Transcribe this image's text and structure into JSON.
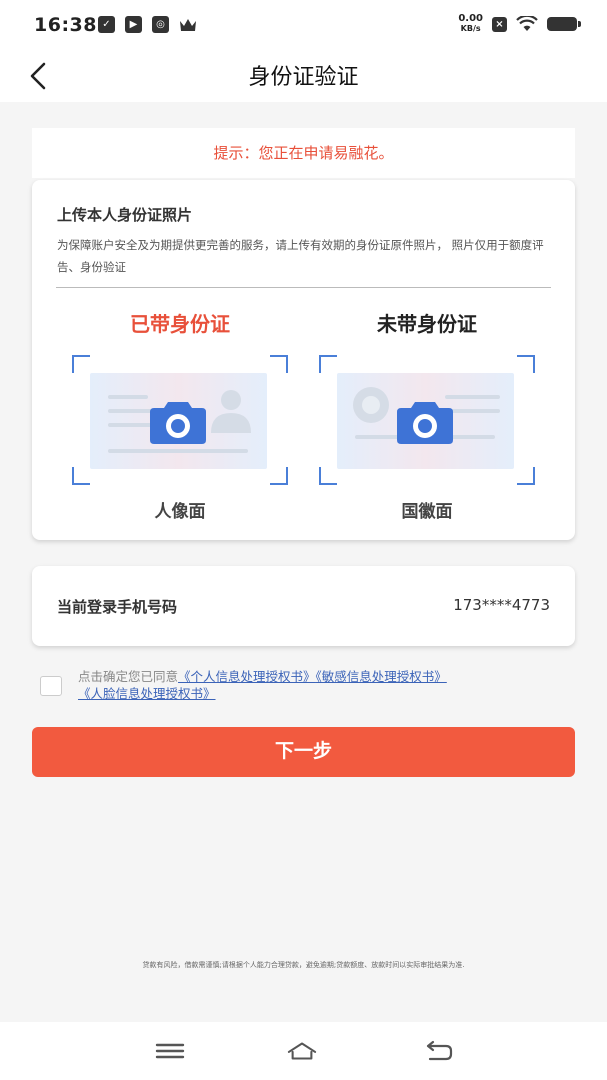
{
  "status_bar": {
    "time": "16:38",
    "net_speed_value": "0.00",
    "net_speed_unit": "KB/s"
  },
  "header": {
    "title": "身份证验证"
  },
  "notice": {
    "text": "提示：您正在申请易融花。"
  },
  "upload": {
    "title": "上传本人身份证照片",
    "description": "为保障账户安全及为期提供更完善的服务，请上传有效期的身份证原件照片， 照片仅用于额度评告、身份验证",
    "with_id_heading": "已带身份证",
    "without_id_heading": "未带身份证",
    "front_caption": "人像面",
    "back_caption": "国徽面"
  },
  "phone": {
    "label": "当前登录手机号码",
    "value": "173****4773"
  },
  "agreement": {
    "prefix": "点击确定您已同意",
    "link1": "《个人信息处理授权书》",
    "link2": "《敏感信息处理授权书》",
    "link3": "《人脸信息处理授权书》"
  },
  "next_button": "下一步",
  "disclaimer": "贷款有风险，借款需谨慎;请根据个人能力合理贷款，避免逾期;贷款额度、放款时间以实际审批结果为准.",
  "colors": {
    "accent": "#f25a3f",
    "notice_text": "#e8503a",
    "link": "#3b63b8",
    "frame": "#4a7fd8"
  }
}
